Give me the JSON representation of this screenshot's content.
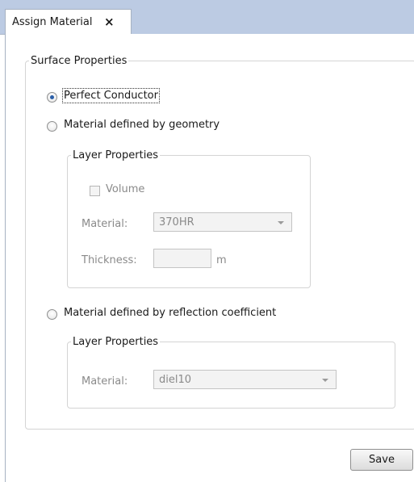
{
  "tab": {
    "label": "Assign Material",
    "close": "×"
  },
  "surface": {
    "legend": "Surface Properties",
    "options": [
      {
        "label": "Perfect Conductor",
        "checked": true
      },
      {
        "label": "Material defined by geometry",
        "checked": false
      },
      {
        "label": "Material defined by reflection coefficient",
        "checked": false
      }
    ]
  },
  "layer1": {
    "legend": "Layer Properties",
    "volume_label": "Volume",
    "material_label": "Material:",
    "material_value": "370HR",
    "thickness_label": "Thickness:",
    "thickness_unit": "m"
  },
  "layer2": {
    "legend": "Layer Properties",
    "material_label": "Material:",
    "material_value": "diel10"
  },
  "save_label": "Save"
}
